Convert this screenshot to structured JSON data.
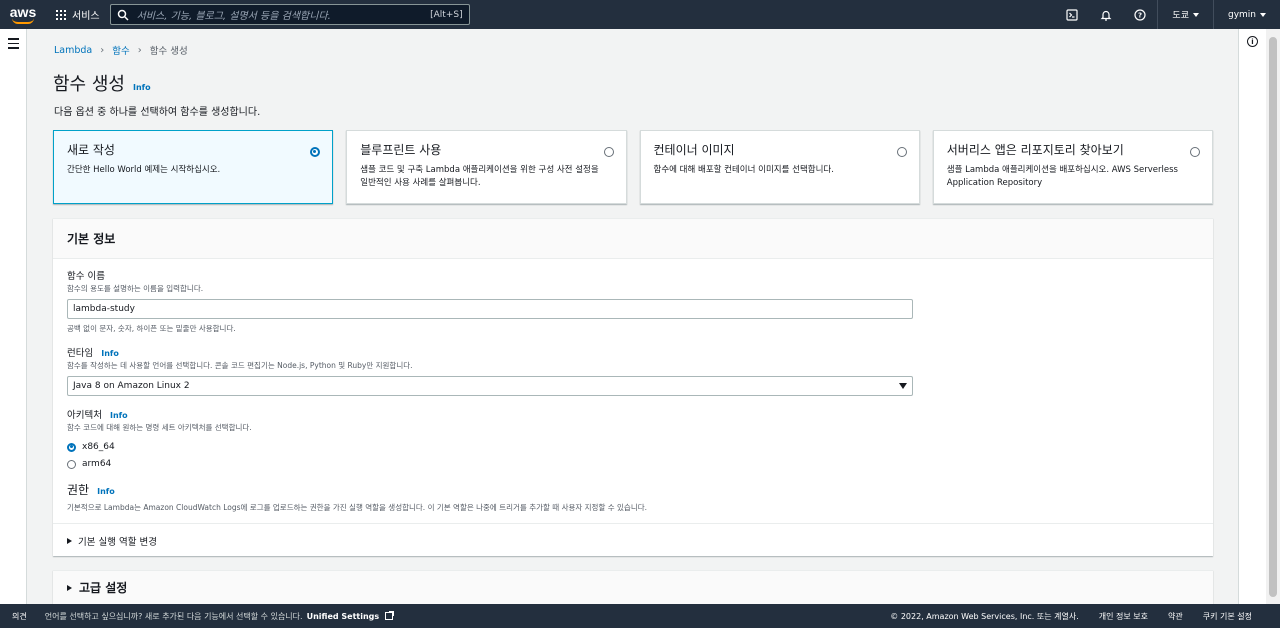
{
  "topnav": {
    "logo": "aws",
    "services": "서비스",
    "search_placeholder": "서비스, 기능, 블로그, 설명서 등을 검색합니다.",
    "search_shortcut": "[Alt+S]",
    "region": "도쿄",
    "user": "gymin",
    "icons": [
      "cloudshell-icon",
      "bell-icon",
      "help-icon"
    ]
  },
  "breadcrumb": [
    "Lambda",
    "함수",
    "함수 생성"
  ],
  "page": {
    "title": "함수 생성",
    "info": "Info",
    "description": "다음 옵션 중 하나를 선택하여 함수를 생성합니다."
  },
  "options": [
    {
      "title": "새로 작성",
      "desc": "간단한 Hello World 예제는 시작하십시오.",
      "selected": true
    },
    {
      "title": "블루프린트 사용",
      "desc": "샘플 코드 및 구축 Lambda 애플리케이션을 위한 구성 사전 설정을 일반적인 사용 사례를 살펴봅니다.",
      "selected": false
    },
    {
      "title": "컨테이너 이미지",
      "desc": "함수에 대해 배포할 컨테이너 이미지를 선택합니다.",
      "selected": false
    },
    {
      "title": "서버리스 앱은 리포지토리 찾아보기",
      "desc": "샘플 Lambda 애플리케이션을 배포하십시오. AWS Serverless Application Repository",
      "selected": false
    }
  ],
  "basic": {
    "header": "기본 정보",
    "fn_name_label": "함수 이름",
    "fn_name_desc": "함수의 용도를 설명하는 이름을 입력합니다.",
    "fn_name_value": "lambda-study",
    "fn_name_constraint": "공백 없이 문자, 숫자, 하이픈 또는 밑줄만 사용합니다.",
    "runtime_label": "런타임",
    "runtime_desc": "함수를 작성하는 데 사용할 언어를 선택합니다. 콘솔 코드 편집기는 Node.js, Python 및 Ruby만 지원합니다.",
    "runtime_value": "Java 8 on Amazon Linux 2",
    "arch_label": "아키텍처",
    "arch_desc": "함수 코드에 대해 원하는 명령 세트 아키텍처를 선택합니다.",
    "arch_options": [
      "x86_64",
      "arm64"
    ],
    "perm_label": "권한",
    "perm_desc": "기본적으로 Lambda는 Amazon CloudWatch Logs에 로그를 업로드하는 권한을 가진 실행 역할을 생성합니다. 이 기본 역할은 나중에 트리거를 추가할 때 사용자 지정할 수 있습니다.",
    "exec_role": "기본 실행 역할 변경",
    "info": "Info"
  },
  "advanced": {
    "label": "고급 설정"
  },
  "footer": {
    "feedback": "의견",
    "lang_text": "언어를 선택하고 싶으십니까? 새로 추가된 다음 기능에서 선택할 수 있습니다.",
    "unified": "Unified Settings",
    "copyright": "© 2022, Amazon Web Services, Inc. 또는 계열사.",
    "privacy": "개인 정보 보호",
    "terms": "약관",
    "cookies": "쿠키 기본 설정"
  }
}
